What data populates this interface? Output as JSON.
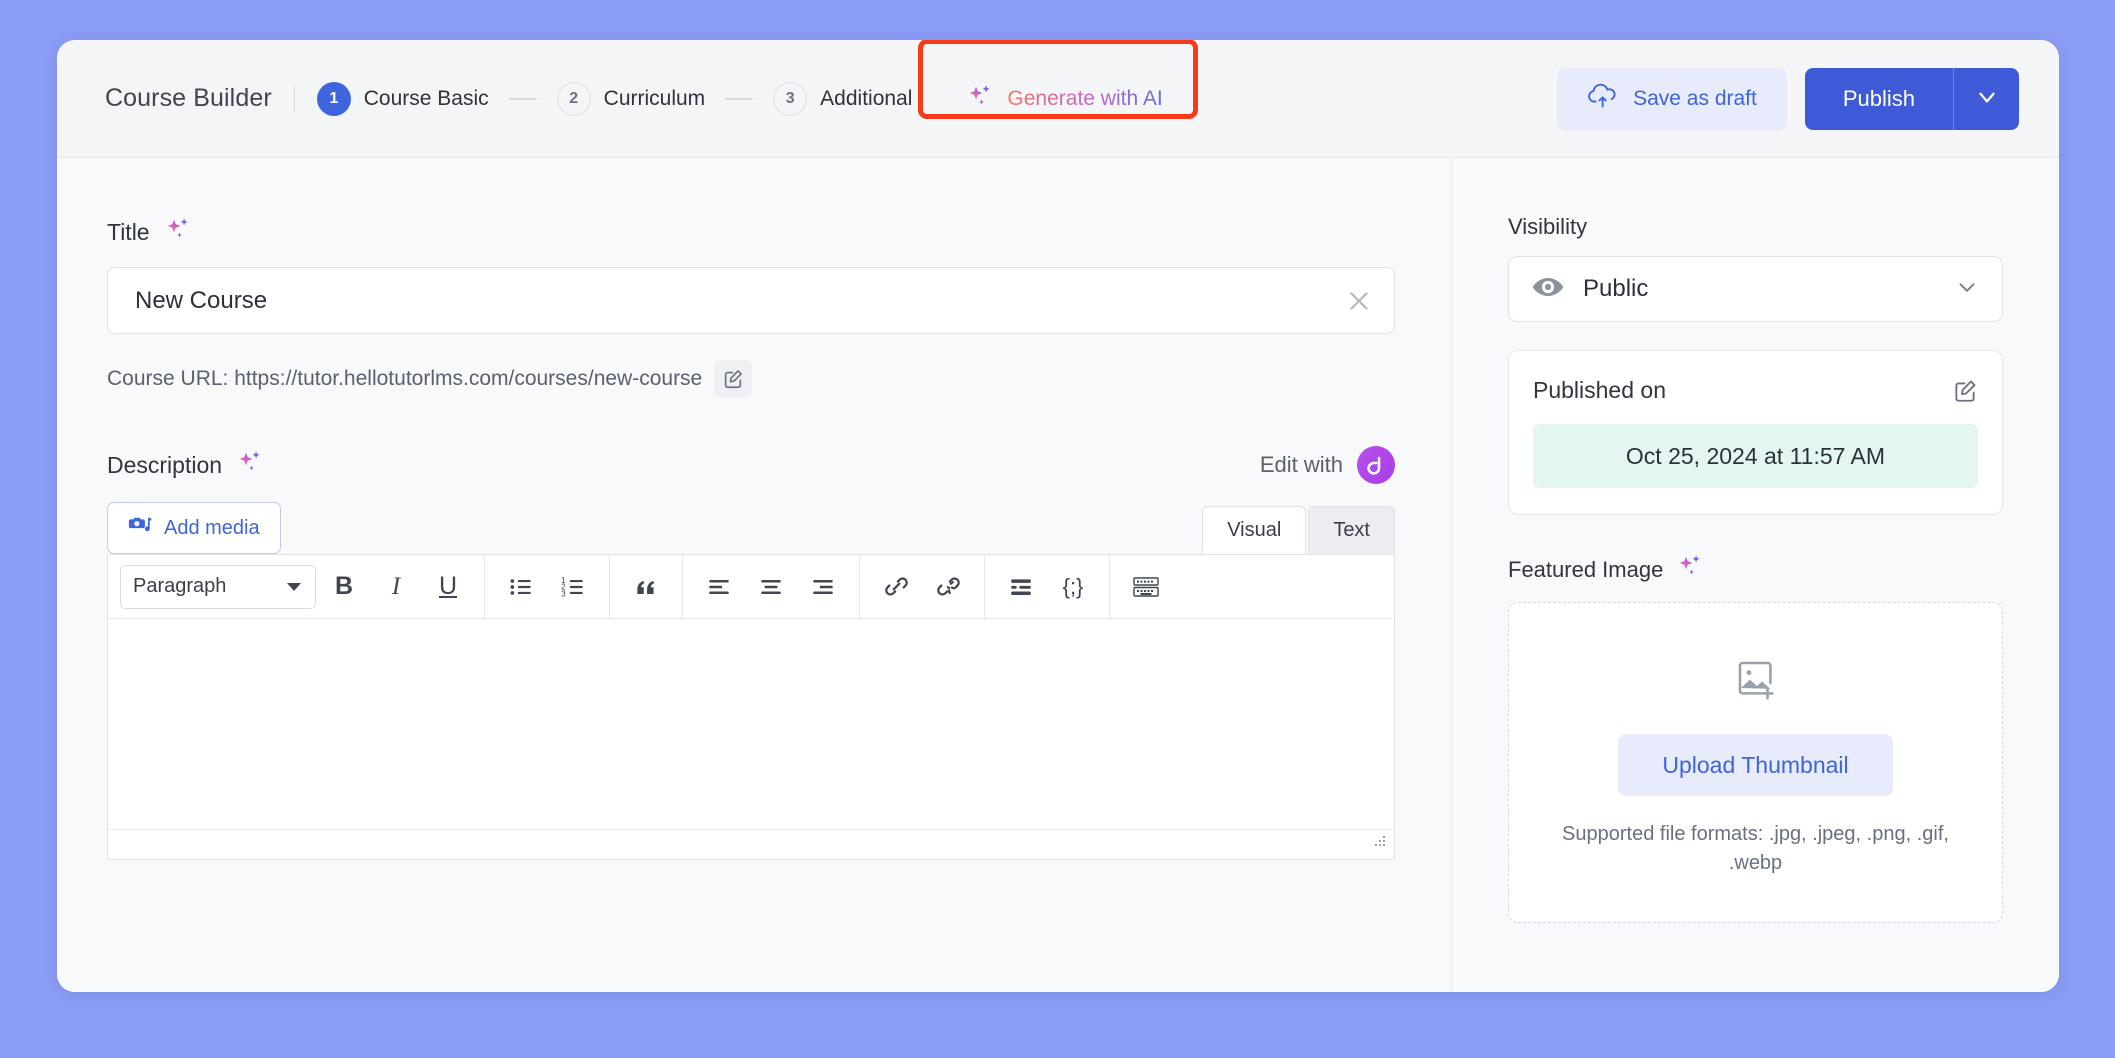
{
  "window": {
    "background_color": "#8b9cf5",
    "surface_color": "#ffffff"
  },
  "header": {
    "brand_title": "Course Builder",
    "steps": [
      {
        "number": "1",
        "label": "Course Basic",
        "state": "active"
      },
      {
        "number": "2",
        "label": "Curriculum",
        "state": "inactive"
      },
      {
        "number": "3",
        "label": "Additional",
        "state": "inactive"
      }
    ],
    "generate_ai": {
      "label": "Generate with AI",
      "icon": "sparkle-icon",
      "highlight_color": "#f93a18",
      "gradient_from": "#f4756b",
      "gradient_to": "#5b6fe0"
    },
    "save_draft": {
      "label": "Save as draft",
      "icon": "cloud-upload-icon"
    },
    "publish": {
      "label": "Publish",
      "caret_icon": "chevron-down-icon",
      "color": "#3e5ad6"
    }
  },
  "main": {
    "title_field": {
      "label": "Title",
      "ai_icon": "sparkle-icon",
      "value": "New Course",
      "placeholder": "Course title",
      "clear_icon": "close-icon"
    },
    "course_url": {
      "text": "Course URL: https://tutor.hellotutorlms.com/courses/new-course",
      "edit_icon": "edit-pencil-icon"
    },
    "description": {
      "label": "Description",
      "ai_icon": "sparkle-icon",
      "edit_with_label": "Edit with",
      "edit_with_logo": "droip-logo-icon",
      "add_media_label": "Add media",
      "add_media_icon": "media-camera-icon",
      "tabs": [
        {
          "label": "Visual",
          "active": true
        },
        {
          "label": "Text",
          "active": false
        }
      ],
      "toolbar": {
        "format_select": {
          "value": "Paragraph",
          "caret_icon": "caret-down-icon"
        },
        "buttons": [
          {
            "name": "bold-icon",
            "glyph": "B"
          },
          {
            "name": "italic-icon",
            "glyph": "I"
          },
          {
            "name": "underline-icon",
            "glyph": "U"
          },
          {
            "name": "bulleted-list-icon",
            "glyph": ""
          },
          {
            "name": "numbered-list-icon",
            "glyph": ""
          },
          {
            "name": "blockquote-icon",
            "glyph": "“"
          },
          {
            "name": "align-left-icon",
            "glyph": ""
          },
          {
            "name": "align-center-icon",
            "glyph": ""
          },
          {
            "name": "align-right-icon",
            "glyph": ""
          },
          {
            "name": "insert-link-icon",
            "glyph": ""
          },
          {
            "name": "remove-link-icon",
            "glyph": ""
          },
          {
            "name": "read-more-icon",
            "glyph": ""
          },
          {
            "name": "source-code-icon",
            "glyph": "{;}"
          },
          {
            "name": "toggle-toolbar-icon",
            "glyph": ""
          }
        ]
      },
      "content": ""
    }
  },
  "sidebar": {
    "visibility": {
      "label": "Visibility",
      "value": "Public",
      "icon": "eye-icon",
      "caret_icon": "chevron-down-icon"
    },
    "published": {
      "title": "Published on",
      "edit_icon": "edit-pencil-icon",
      "date": "Oct 25, 2024 at 11:57 AM",
      "pill_color": "#e4f6f1"
    },
    "featured_image": {
      "label": "Featured Image",
      "ai_icon": "sparkle-icon",
      "placeholder_icon": "image-add-icon",
      "upload_label": "Upload Thumbnail",
      "formats_text": "Supported file formats: .jpg, .jpeg, .png, .gif, .webp"
    }
  }
}
